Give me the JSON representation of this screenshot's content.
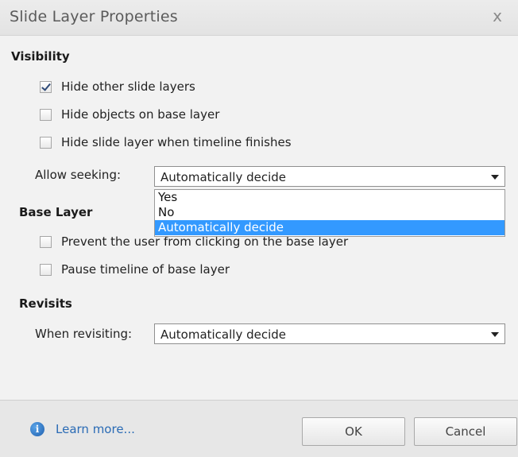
{
  "dialog": {
    "title": "Slide Layer Properties",
    "close_label": "x"
  },
  "visibility": {
    "heading": "Visibility",
    "options": [
      {
        "label": "Hide other slide layers",
        "checked": true
      },
      {
        "label": "Hide objects on base layer",
        "checked": false
      },
      {
        "label": "Hide slide layer when timeline finishes",
        "checked": false
      }
    ],
    "seek_label": "Allow seeking:",
    "seek_value": "Automatically decide",
    "seek_options": [
      "Yes",
      "No",
      "Automatically decide"
    ],
    "seek_selected_index": 2
  },
  "base_layer": {
    "heading": "Base Layer",
    "options": [
      {
        "label": "Prevent the user from clicking on the base layer",
        "checked": false
      },
      {
        "label": "Pause timeline of base layer",
        "checked": false
      }
    ]
  },
  "revisits": {
    "heading": "Revisits",
    "label": "When revisiting:",
    "value": "Automatically decide"
  },
  "footer": {
    "info_icon_glyph": "i",
    "learn_more": "Learn more...",
    "ok": "OK",
    "cancel": "Cancel"
  },
  "colors": {
    "highlight": "#3399ff",
    "link": "#2a6bb5"
  }
}
